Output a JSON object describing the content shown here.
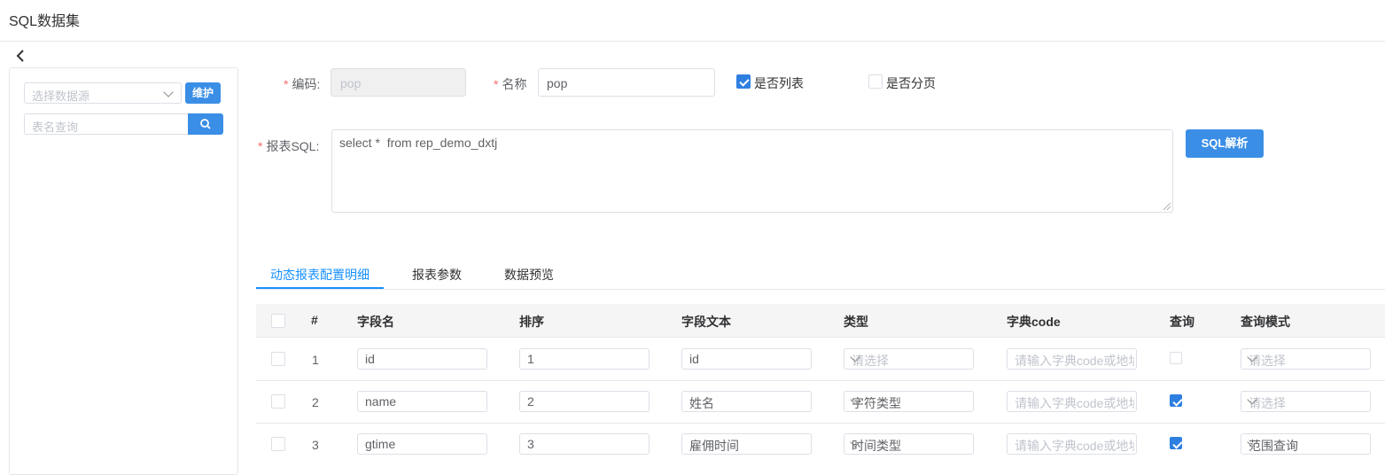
{
  "page": {
    "title": "SQL数据集"
  },
  "left": {
    "datasource_placeholder": "选择数据源",
    "maintain_label": "维护",
    "table_search_placeholder": "表名查询"
  },
  "form": {
    "code_label": "编码:",
    "code_value": "pop",
    "name_label": "名称",
    "name_value": "pop",
    "is_list_label": "是否列表",
    "is_list_checked": true,
    "is_paged_label": "是否分页",
    "is_paged_checked": false,
    "sql_label": "报表SQL:",
    "sql_value": "select *  from rep_demo_dxtj",
    "parse_button": "SQL解析",
    "required_mark": "*"
  },
  "tabs": [
    "动态报表配置明细",
    "报表参数",
    "数据预览"
  ],
  "table": {
    "headers": [
      "#",
      "字段名",
      "排序",
      "字段文本",
      "类型",
      "字典code",
      "查询",
      "查询模式"
    ],
    "rows": [
      {
        "num": "1",
        "field": "id",
        "order": "1",
        "text": "id",
        "type": "请选择",
        "type_ph": true,
        "dict": "请输入字典code或地址",
        "query": false,
        "mode": "请选择",
        "mode_ph": true
      },
      {
        "num": "2",
        "field": "name",
        "order": "2",
        "text": "姓名",
        "type": "字符类型",
        "type_ph": false,
        "dict": "请输入字典code或地址",
        "query": true,
        "mode": "请选择",
        "mode_ph": true
      },
      {
        "num": "3",
        "field": "gtime",
        "order": "3",
        "text": "雇佣时间",
        "type": "时间类型",
        "type_ph": false,
        "dict": "请输入字典code或地址",
        "query": true,
        "mode": "范围查询",
        "mode_ph": false
      }
    ]
  },
  "colors": {
    "primary": "#3a8ee6",
    "checked": "#2e7fe0",
    "required": "#f56c6c",
    "tab_active": "#1890ff"
  }
}
